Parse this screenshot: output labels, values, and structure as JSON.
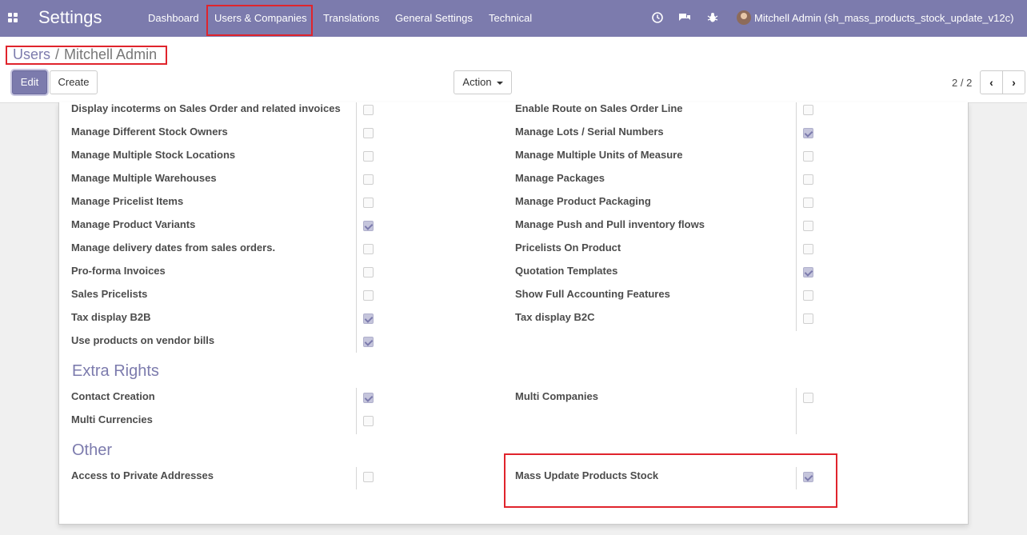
{
  "app": {
    "title": "Settings"
  },
  "menu": [
    {
      "label": "Dashboard"
    },
    {
      "label": "Users & Companies"
    },
    {
      "label": "Translations"
    },
    {
      "label": "General Settings"
    },
    {
      "label": "Technical"
    }
  ],
  "systray": {
    "icons": [
      "clock-icon",
      "chat-icon",
      "bug-icon"
    ],
    "user": "Mitchell Admin (sh_mass_products_stock_update_v12c)"
  },
  "breadcrumb": {
    "parent": "Users",
    "separator": "/",
    "current": "Mitchell Admin"
  },
  "buttons": {
    "edit": "Edit",
    "create": "Create",
    "action": "Action"
  },
  "pager": {
    "value": "2 / 2"
  },
  "colors": {
    "navbar": "#7c7bad",
    "accent": "#7c7bad",
    "highlight": "#e0242c"
  },
  "rights": {
    "left": [
      {
        "label": "Display incoterms on Sales Order and related invoices",
        "checked": false
      },
      {
        "label": "Manage Different Stock Owners",
        "checked": false
      },
      {
        "label": "Manage Multiple Stock Locations",
        "checked": false
      },
      {
        "label": "Manage Multiple Warehouses",
        "checked": false
      },
      {
        "label": "Manage Pricelist Items",
        "checked": false
      },
      {
        "label": "Manage Product Variants",
        "checked": true
      },
      {
        "label": "Manage delivery dates from sales orders.",
        "checked": false
      },
      {
        "label": "Pro-forma Invoices",
        "checked": false
      },
      {
        "label": "Sales Pricelists",
        "checked": false
      },
      {
        "label": "Tax display B2B",
        "checked": true
      },
      {
        "label": "Use products on vendor bills",
        "checked": true
      }
    ],
    "right": [
      {
        "label": "Enable Route on Sales Order Line",
        "checked": false
      },
      {
        "label": "Manage Lots / Serial Numbers",
        "checked": true
      },
      {
        "label": "Manage Multiple Units of Measure",
        "checked": false
      },
      {
        "label": "Manage Packages",
        "checked": false
      },
      {
        "label": "Manage Product Packaging",
        "checked": false
      },
      {
        "label": "Manage Push and Pull inventory flows",
        "checked": false
      },
      {
        "label": "Pricelists On Product",
        "checked": false
      },
      {
        "label": "Quotation Templates",
        "checked": true
      },
      {
        "label": "Show Full Accounting Features",
        "checked": false
      },
      {
        "label": "Tax display B2C",
        "checked": false
      }
    ]
  },
  "extra_rights": {
    "title": "Extra Rights",
    "left": [
      {
        "label": "Contact Creation",
        "checked": true
      },
      {
        "label": "Multi Currencies",
        "checked": false
      }
    ],
    "right": [
      {
        "label": "Multi Companies",
        "checked": false
      }
    ]
  },
  "other": {
    "title": "Other",
    "left": [
      {
        "label": "Access to Private Addresses",
        "checked": false
      }
    ],
    "right": [
      {
        "label": "Mass Update Products Stock",
        "checked": true
      }
    ]
  }
}
